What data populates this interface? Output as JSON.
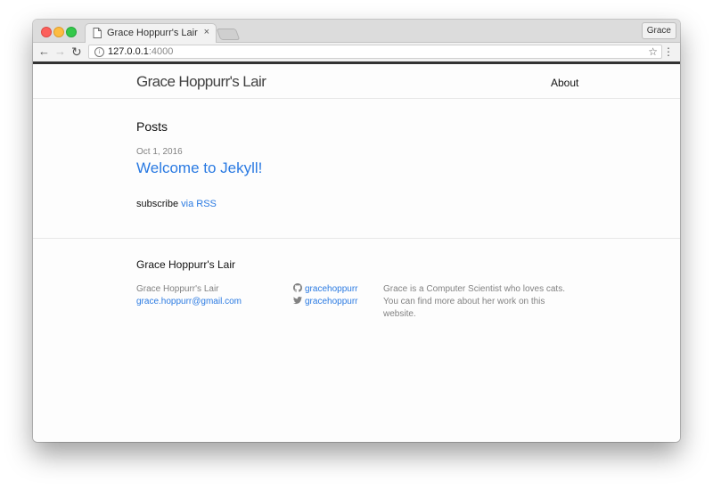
{
  "browser": {
    "tab_title": "Grace Hoppurr's Lair",
    "tab_close": "×",
    "profile_label": "Grace",
    "url_host": "127.0.0.1",
    "url_port": ":4000",
    "back_glyph": "←",
    "forward_glyph": "→",
    "reload_glyph": "↻",
    "star_glyph": "☆",
    "menu_glyph": "⋮",
    "info_glyph": "i",
    "traffic_colors": {
      "close": "#fc605c",
      "minimize": "#fdbc40",
      "maximize": "#34c84a"
    }
  },
  "site": {
    "title": "Grace Hoppurr's Lair",
    "nav": [
      {
        "label": "About"
      }
    ],
    "accent_color": "#2a7ae2"
  },
  "posts": {
    "heading": "Posts",
    "items": [
      {
        "date": "Oct 1, 2016",
        "title": "Welcome to Jekyll!"
      }
    ]
  },
  "subscribe": {
    "prefix": "subscribe ",
    "link_label": "via RSS"
  },
  "footer": {
    "heading": "Grace Hoppurr's Lair",
    "name": "Grace Hoppurr's Lair",
    "email": "grace.hoppurr@gmail.com",
    "github": {
      "icon": "github-icon",
      "username": "gracehoppurr"
    },
    "twitter": {
      "icon": "twitter-icon",
      "username": "gracehoppurr"
    },
    "description": "Grace is a Computer Scientist who loves cats. You can find more about her work on this website."
  }
}
